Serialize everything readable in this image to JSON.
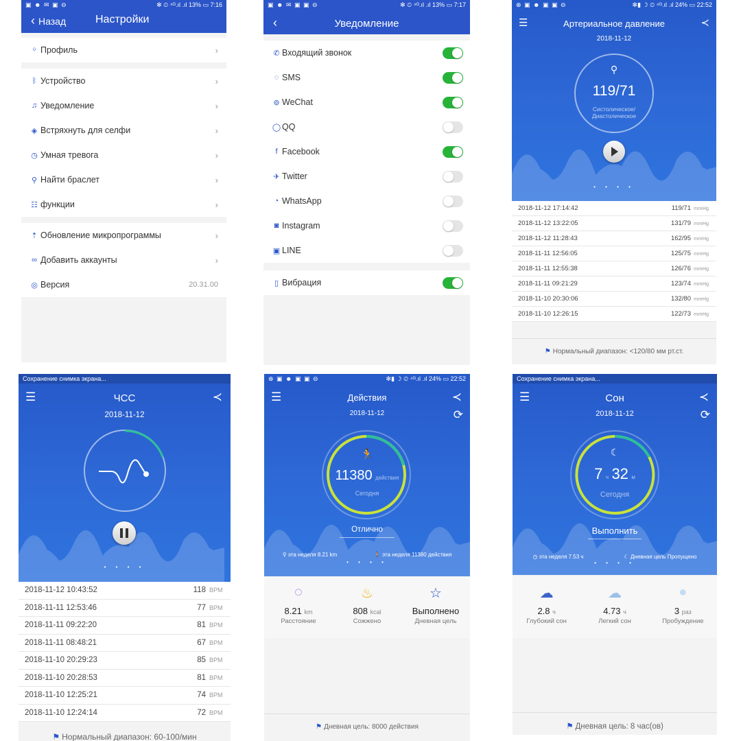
{
  "settings": {
    "status_left": "▣ ☻ ✉ ▣ ⊖",
    "status_right": "✻ ⏲ ⁴ᴳ.ıl .ıl 13% ▭ 7:16",
    "back_label": "Назад",
    "title": "Настройки",
    "group1": [
      {
        "icon": "person-icon",
        "glyph": "ᛜ",
        "label": "Профиль"
      }
    ],
    "group2": [
      {
        "icon": "bluetooth-icon",
        "glyph": "ᛒ",
        "label": "Устройство"
      },
      {
        "icon": "bell-icon",
        "glyph": "🔔",
        "label": "Уведомление"
      },
      {
        "icon": "camera-shake-icon",
        "glyph": "◈",
        "label": "Встряхнуть для селфи"
      },
      {
        "icon": "clock-icon",
        "glyph": "◷",
        "label": "Умная тревога"
      },
      {
        "icon": "search-icon",
        "glyph": "⚲",
        "label": "Найти браслет"
      },
      {
        "icon": "functions-icon",
        "glyph": "☷",
        "label": "функции"
      }
    ],
    "group3": [
      {
        "icon": "firmware-update-icon",
        "glyph": "⇡",
        "label": "Обновление микропрограммы"
      },
      {
        "icon": "link-icon",
        "glyph": "∞",
        "label": "Добавить аккаунты"
      }
    ],
    "version": {
      "icon": "layers-icon",
      "glyph": "◎",
      "label": "Версия",
      "value": "20.31.00"
    }
  },
  "notifications": {
    "status_left": "▣ ☻ ✉ ▣ ▣ ⊖",
    "status_right": "✻ ⏲ ⁴ᴳ.ıl .ıl 13% ▭ 7:17",
    "title": "Уведомление",
    "items": [
      {
        "icon": "incoming-call-icon",
        "glyph": "✆",
        "label": "Входящий звонок",
        "on": true
      },
      {
        "icon": "sms-icon",
        "glyph": "◌",
        "label": "SMS",
        "on": true
      },
      {
        "icon": "wechat-icon",
        "glyph": "⊚",
        "label": "WeChat",
        "on": true
      },
      {
        "icon": "qq-icon",
        "glyph": "◯",
        "label": "QQ",
        "on": false
      },
      {
        "icon": "facebook-icon",
        "glyph": "f",
        "label": "Facebook",
        "on": true
      },
      {
        "icon": "twitter-icon",
        "glyph": "✈",
        "label": "Twitter",
        "on": false
      },
      {
        "icon": "whatsapp-icon",
        "glyph": "◔",
        "label": "WhatsApp",
        "on": false
      },
      {
        "icon": "instagram-icon",
        "glyph": "◙",
        "label": "Instagram",
        "on": false
      },
      {
        "icon": "line-icon",
        "glyph": "▣",
        "label": "LINE",
        "on": false
      }
    ],
    "vibration": {
      "icon": "vibration-icon",
      "glyph": "▯",
      "label": "Вибрация",
      "on": true
    }
  },
  "blood_pressure": {
    "status_left": "⊗ ▣ ☻ ▣ ▣ ⊖",
    "status_right": "✻▮ ☽ ⏲ ⁴ᴳ.ıl .ıl 24% ▭ 22:52",
    "title": "Артериальное давление",
    "date": "2018-11-12",
    "value": "119/71",
    "sublabel1": "Систолическое/",
    "sublabel2": "Диастолическое",
    "dots": "• • • •",
    "rows": [
      {
        "date": "2018-11-12 17:14:42",
        "value": "119/71",
        "unit": "mmHg"
      },
      {
        "date": "2018-11-12 13:22:05",
        "value": "131/79",
        "unit": "mmHg"
      },
      {
        "date": "2018-11-12 11:28:43",
        "value": "162/95",
        "unit": "mmHg"
      },
      {
        "date": "2018-11-11 12:56:05",
        "value": "125/75",
        "unit": "mmHg"
      },
      {
        "date": "2018-11-11 12:55:38",
        "value": "126/76",
        "unit": "mmHg"
      },
      {
        "date": "2018-11-11 09:21:29",
        "value": "123/74",
        "unit": "mmHg"
      },
      {
        "date": "2018-11-10 20:30:06",
        "value": "132/80",
        "unit": "mmHg"
      },
      {
        "date": "2018-11-10 12:26:15",
        "value": "122/73",
        "unit": "mmHg"
      }
    ],
    "footer": "Нормальный диапазон: <120/80 мм рт.ст."
  },
  "heart_rate": {
    "status_left": "Сохранение снимка экрана...",
    "title": "ЧСС",
    "date": "2018-11-12",
    "dots": "• • • •",
    "rows": [
      {
        "date": "2018-11-12 10:43:52",
        "value": "118",
        "unit": "BPM"
      },
      {
        "date": "2018-11-11 12:53:46",
        "value": "77",
        "unit": "BPM"
      },
      {
        "date": "2018-11-11 09:22:20",
        "value": "81",
        "unit": "BPM"
      },
      {
        "date": "2018-11-11 08:48:21",
        "value": "67",
        "unit": "BPM"
      },
      {
        "date": "2018-11-10 20:29:23",
        "value": "85",
        "unit": "BPM"
      },
      {
        "date": "2018-11-10 20:28:53",
        "value": "81",
        "unit": "BPM"
      },
      {
        "date": "2018-11-10 12:25:21",
        "value": "74",
        "unit": "BPM"
      },
      {
        "date": "2018-11-10 12:24:14",
        "value": "72",
        "unit": "BPM"
      }
    ],
    "footer": "Нормальный диапазон: 60-100/мин"
  },
  "activity": {
    "status_left": "⊗ ▣ ☻ ▣ ▣ ⊖",
    "status_right": "✻▮ ☽ ⏲ ⁴ᴳ.ıl .ıl 24% ▭ 22:52",
    "title": "Действия",
    "date": "2018-11-12",
    "steps": "11380",
    "steps_unit": "действия",
    "today": "Сегодня",
    "status": "Отлично",
    "week_distance": "эта неделя 8.21 km",
    "week_steps": "эта неделя 11380 действия",
    "dots": "• • • •",
    "stats": [
      {
        "icon": "distance-icon",
        "glyph": "◌",
        "color": "#8a4fd0",
        "value": "8.21",
        "unit": "km",
        "label": "Расстояние"
      },
      {
        "icon": "flame-icon",
        "glyph": "♨",
        "color": "#f2b21a",
        "value": "808",
        "unit": "kcal",
        "label": "Сожжено"
      },
      {
        "icon": "star-icon",
        "glyph": "☆",
        "color": "#2b55c8",
        "value": "Выполнено",
        "unit": "",
        "label": "Дневная цель"
      }
    ],
    "footer": "Дневная цель: 8000 действия"
  },
  "sleep": {
    "status_left": "Сохранение снимка экрана...",
    "title": "Сон",
    "date": "2018-11-12",
    "hours": "7",
    "hours_unit": "ч",
    "minutes": "32",
    "minutes_unit": "м",
    "today": "Сегодня",
    "status": "Выполнить",
    "week_sleep": "эта неделя 7.53 ч",
    "goal_state": "Дневная цель Пропущено",
    "dots": "• • • •",
    "stats": [
      {
        "icon": "deep-sleep-icon",
        "glyph": "☁",
        "color": "#3c64c8",
        "value": "2.8",
        "unit": "ч",
        "label": "Глубокий сон"
      },
      {
        "icon": "light-sleep-icon",
        "glyph": "☁",
        "color": "#9cc0ea",
        "value": "4.73",
        "unit": "ч",
        "label": "Легкий сон"
      },
      {
        "icon": "wake-icon",
        "glyph": "●",
        "color": "#c4dcf2",
        "value": "3",
        "unit": "раз",
        "label": "Пробуждение"
      }
    ],
    "footer": "Дневная цель: 8 час(ов)"
  }
}
